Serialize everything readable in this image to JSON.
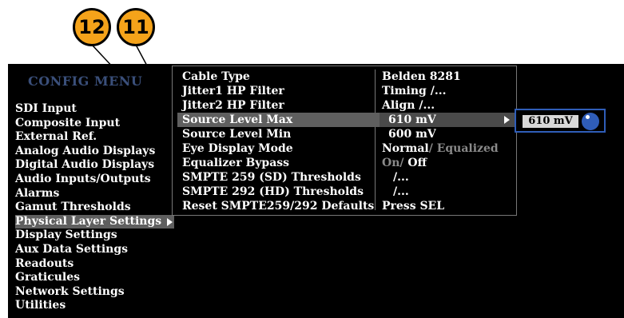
{
  "callouts": [
    "12",
    "11"
  ],
  "config_menu": {
    "title": "CONFIG MENU",
    "items": [
      "SDI Input",
      "Composite Input",
      "External Ref.",
      "Analog Audio Displays",
      "Digital Audio Displays",
      "Audio Inputs/Outputs",
      "Alarms",
      "Gamut Thresholds",
      "Physical Layer Settings",
      "Display Settings",
      "Aux Data Settings",
      "Readouts",
      "Graticules",
      "Network Settings",
      "Utilities"
    ],
    "selected_index": 8
  },
  "submenu": {
    "rows": [
      {
        "label": "Cable Type",
        "value": "Belden 8281"
      },
      {
        "label": "Jitter1 HP Filter",
        "value": "Timing /..."
      },
      {
        "label": "Jitter2 HP Filter",
        "value": "Align /..."
      },
      {
        "label": "Source Level Max",
        "value": "610 mV"
      },
      {
        "label": "Source Level Min",
        "value": "600 mV"
      },
      {
        "label": "Eye Display Mode",
        "value_a": "Normal",
        "value_b": "/ Equalized"
      },
      {
        "label": "Equalizer Bypass",
        "value_a": "On/",
        "value_b": " Off"
      },
      {
        "label": "SMPTE 259 (SD) Thresholds",
        "value": "/..."
      },
      {
        "label": "SMPTE 292 (HD) Thresholds",
        "value": "/..."
      },
      {
        "label": "Reset SMPTE259/292 Defaults",
        "value": "Press SEL"
      }
    ],
    "highlighted_index": 3
  },
  "value_editor": {
    "value": "610 mV"
  },
  "colors": {
    "callout": "#f5a31a",
    "screen_bg": "#000000",
    "highlight": "#5f5f5f",
    "accent_blue": "#2f5db8",
    "menu_title": "#3a4f7a"
  }
}
